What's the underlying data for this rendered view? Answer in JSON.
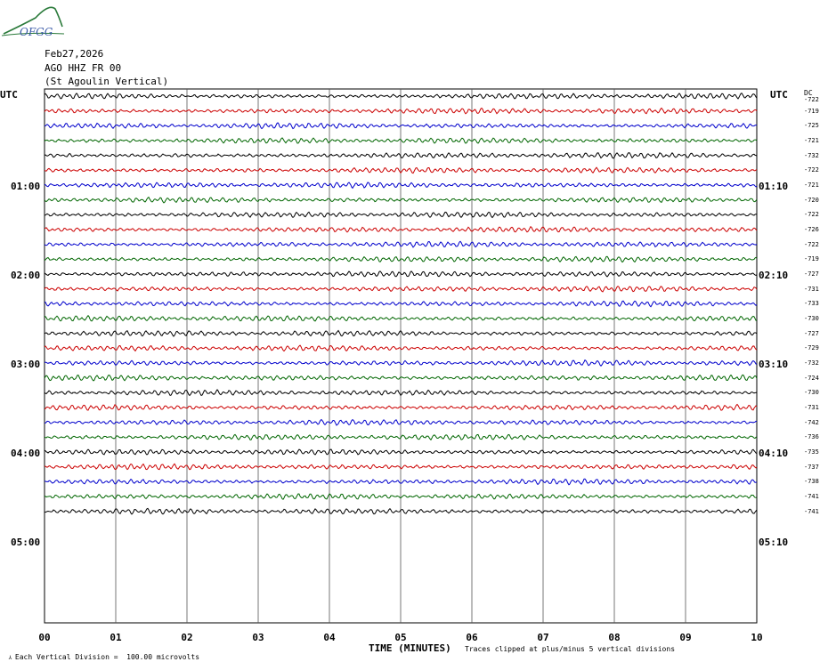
{
  "logo": {
    "text": "OFGG"
  },
  "header": {
    "date": "Feb27,2026",
    "station": "AGO HHZ FR 00",
    "location": "(St Agoulin Vertical)"
  },
  "utc_left": "UTC",
  "utc_right": "UTC",
  "dc_label": "DC",
  "left_times": [
    "01:00",
    "02:00",
    "03:00",
    "04:00",
    "05:00"
  ],
  "right_times": [
    "01:10",
    "02:10",
    "03:10",
    "04:10",
    "05:10"
  ],
  "footer": {
    "scale_note": "Each Vertical Division =  100.00 microvolts",
    "xlabel": "TIME (MINUTES)",
    "clip_note": "Traces clipped at plus/minus 5 vertical divisions"
  },
  "chart_data": {
    "type": "line",
    "title": "AGO HHZ FR 00 (St Agoulin Vertical)",
    "xlabel": "TIME (MINUTES)",
    "xlim": [
      0,
      10
    ],
    "x_ticks": [
      "00",
      "01",
      "02",
      "03",
      "04",
      "05",
      "06",
      "07",
      "08",
      "09",
      "10"
    ],
    "trace_colors": [
      "#000000",
      "#cc0000",
      "#0000cc",
      "#006600"
    ],
    "num_traces": 29,
    "trace_dc_offsets": [
      -722,
      -719,
      -725,
      -721,
      -732,
      -722,
      -721,
      -720,
      -722,
      -726,
      -722,
      -719,
      -727,
      -731,
      -733,
      -730,
      -727,
      -729,
      -732,
      -724,
      -730,
      -731,
      -742,
      -736,
      -735,
      -737,
      -738,
      -741,
      -741
    ]
  }
}
